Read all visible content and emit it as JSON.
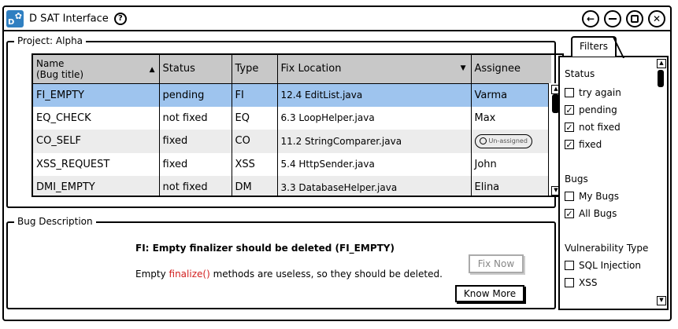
{
  "window": {
    "title": "D SAT Interface"
  },
  "project": {
    "legend": "Project: Alpha",
    "columns": [
      "Name\n(Bug title)",
      "Status",
      "Type",
      "Fix Location",
      "Assignee"
    ],
    "rows": [
      {
        "name": "FI_EMPTY",
        "status": "pending",
        "type": "FI",
        "fix": "12.4 EditList.java",
        "assignee": "Varma"
      },
      {
        "name": "EQ_CHECK",
        "status": "not fixed",
        "type": "EQ",
        "fix": "6.3 LoopHelper.java",
        "assignee": "Max"
      },
      {
        "name": "CO_SELF",
        "status": "fixed",
        "type": "CO",
        "fix": "11.2 StringComparer.java",
        "assignee": "Un-assigned"
      },
      {
        "name": "XSS_REQUEST",
        "status": "fixed",
        "type": "XSS",
        "fix": "5.4 HttpSender.java",
        "assignee": "John"
      },
      {
        "name": "DMI_EMPTY",
        "status": "not fixed",
        "type": "DM",
        "fix": "3.3 DatabaseHelper.java",
        "assignee": "Elina"
      }
    ]
  },
  "bug": {
    "legend": "Bug Description",
    "title": "FI: Empty finalizer should be deleted (FI_EMPTY)",
    "text_before": "Empty ",
    "text_code": "finalize()",
    "text_after": " methods are useless, so they should be deleted.",
    "fix_now": "Fix Now",
    "know_more": "Know More"
  },
  "filters": {
    "tab": "Filters",
    "status_title": "Status",
    "status": [
      {
        "label": "try again",
        "checked": false
      },
      {
        "label": "pending",
        "checked": true
      },
      {
        "label": "not fixed",
        "checked": true
      },
      {
        "label": "fixed",
        "checked": true
      }
    ],
    "bugs_title": "Bugs",
    "bugs": [
      {
        "label": "My Bugs",
        "checked": false
      },
      {
        "label": "All Bugs",
        "checked": true
      }
    ],
    "vuln_title": "Vulnerability Type",
    "vuln": [
      {
        "label": "SQL Injection",
        "checked": false
      },
      {
        "label": "XSS",
        "checked": false
      }
    ]
  },
  "colors": {
    "selected_row": "#9ec4ee",
    "header": "#c8c8c8",
    "code": "#d21f1f"
  }
}
